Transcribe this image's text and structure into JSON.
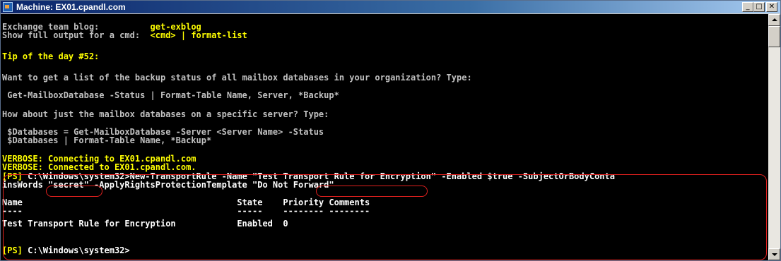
{
  "window": {
    "title": "Machine: EX01.cpandl.com",
    "buttons": {
      "minimize": "_",
      "maximize": "□",
      "close": "✕"
    },
    "icon": "powershell-console-icon"
  },
  "console": {
    "l01": {
      "a": "Exchange team blog:          ",
      "b": "get-exblog"
    },
    "l02": {
      "a": "Show full output for a cmd:  ",
      "b": "<cmd> | format-list"
    },
    "l03": "Tip of the day #52:",
    "l04": "Want to get a list of the backup status of all mailbox databases in your organization? Type:",
    "l05": " Get-MailboxDatabase -Status | Format-Table Name, Server, *Backup*",
    "l06": "How about just the mailbox databases on a specific server? Type:",
    "l07": " $Databases = Get-MailboxDatabase -Server <Server Name> -Status",
    "l08": " $Databases | Format-Table Name, *Backup*",
    "l09": "VERBOSE: Connecting to EX01.cpandl.com",
    "l10": "VERBOSE: Connected to EX01.cpandl.com.",
    "l11": {
      "ps": "[PS]",
      "cmd": " C:\\Windows\\system32>New-TransportRule -Name \"Test Transport Rule for Encryption\" -Enabled $true -SubjectOrBodyConta"
    },
    "l12": "insWords \"secret\" -ApplyRightsProtectionTemplate \"Do Not Forward\"",
    "l13": "Name                                          State    Priority Comments",
    "l14": "----                                          -----    -------- --------",
    "l15": "Test Transport Rule for Encryption            Enabled  0",
    "l16": {
      "ps": "[PS]",
      "cmd": " C:\\Windows\\system32>"
    }
  },
  "colors": {
    "console_bg": "#000000",
    "console_text": "#c0c0c0",
    "highlight_text": "#ffff00",
    "annotation": "#e0201e"
  }
}
